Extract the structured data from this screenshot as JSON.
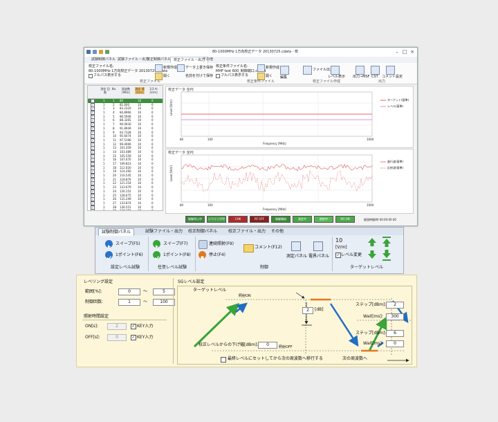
{
  "window": {
    "title": "80-1000MHz 1方向校正データ 20130725.cdata - 校",
    "menu_tabs": [
      "試験制御パネル",
      "試験ファイル・出力",
      "校正制御パネル",
      "校正ファイル・出力",
      "その他"
    ],
    "active_menu_tab": 3,
    "ribbon": {
      "file1_label": "校正ファイル名:",
      "file1_value": "80-1000MHz 1方向校正データ 20130725.cdata",
      "file1_option": "フルパス表示する",
      "new_create": "新規作成",
      "open": "開く",
      "data_save": "データ上書き保存",
      "save_as": "名前を付けて保存",
      "group1": "校正ファイル",
      "file2_label": "校正条件ファイル名:",
      "file2_value": "MHF test 600_制御端口.ccond",
      "file2_option": "フルパス表示する",
      "new_create2": "新規作成",
      "open2": "開く",
      "edit": "編集",
      "group2": "校正条件ファイル",
      "file_output": "ファイル出力",
      "level_sep": "レベル表示",
      "group3": "校正ファイル作成",
      "csv_out": "出力→MSF",
      "cst": "CST",
      "comment": "コメント設定",
      "group4": "出力"
    },
    "table": {
      "headers": [
        "測定\n回数",
        "No.",
        "周波数\n[MHz]",
        "測定\n値\n[V/m]",
        "1/3 Ar\n[V/m]"
      ],
      "rows": [
        [
          "1",
          "1",
          "80",
          "10",
          "0"
        ],
        [
          "1",
          "2",
          "81.600",
          "10",
          "0"
        ],
        [
          "1",
          "3",
          "83.2320",
          "10",
          "0"
        ],
        [
          "1",
          "4",
          "84.8966",
          "10",
          "0"
        ],
        [
          "1",
          "5",
          "86.5946",
          "10",
          "0"
        ],
        [
          "1",
          "6",
          "88.3265",
          "10",
          "0"
        ],
        [
          "1",
          "7",
          "90.0930",
          "10",
          "0"
        ],
        [
          "1",
          "8",
          "91.8949",
          "10",
          "0"
        ],
        [
          "1",
          "9",
          "93.7328",
          "10",
          "0"
        ],
        [
          "1",
          "10",
          "95.6074",
          "10",
          "0"
        ],
        [
          "1",
          "11",
          "97.5196",
          "10",
          "0"
        ],
        [
          "1",
          "12",
          "99.4699",
          "10",
          "0"
        ],
        [
          "1",
          "13",
          "101.459",
          "10",
          "0"
        ],
        [
          "1",
          "14",
          "103.489",
          "10",
          "0"
        ],
        [
          "1",
          "15",
          "105.559",
          "10",
          "0"
        ],
        [
          "1",
          "16",
          "107.670",
          "10",
          "0"
        ],
        [
          "1",
          "17",
          "109.823",
          "10",
          "0"
        ],
        [
          "1",
          "18",
          "112.020",
          "10",
          "0"
        ],
        [
          "1",
          "19",
          "114.260",
          "10",
          "0"
        ],
        [
          "1",
          "20",
          "116.545",
          "10",
          "0"
        ],
        [
          "1",
          "21",
          "118.876",
          "10",
          "0"
        ],
        [
          "1",
          "22",
          "121.254",
          "10",
          "0"
        ],
        [
          "1",
          "23",
          "123.679",
          "10",
          "0"
        ],
        [
          "1",
          "24",
          "126.152",
          "10",
          "0"
        ],
        [
          "1",
          "25",
          "128.675",
          "10",
          "0"
        ],
        [
          "1",
          "26",
          "131.249",
          "10",
          "0"
        ],
        [
          "1",
          "27",
          "133.874",
          "10",
          "0"
        ],
        [
          "1",
          "28",
          "136.551",
          "10",
          "0"
        ],
        [
          "1",
          "29",
          "139.282",
          "10",
          "0"
        ]
      ]
    },
    "chart_top": {
      "title": "校正データ 全円",
      "xlabel": "Frequency [MHz]",
      "ylabel": "Level [V/m]",
      "legend": [
        "ターゲット(基準)",
        "レベル(基準)"
      ],
      "x_ticks": [
        "80",
        "100",
        "1000"
      ]
    },
    "chart_bottom": {
      "title": "校正データ 全円",
      "xlabel": "Frequency [MHz]",
      "ylabel": "Level [V/m]",
      "legend": [
        "進行波(基準)",
        "反射波(基準)"
      ],
      "x_ticks": [
        "80",
        "100",
        "1000"
      ]
    },
    "status_buttons": [
      {
        "label": "制御停止中",
        "color": "#3a8a3a"
      },
      {
        "label": "レベリング中",
        "color": "#4a9d4a"
      },
      {
        "label": "CHK",
        "color": "#b02a2a"
      },
      {
        "label": "RF OFF",
        "color": "#8a1f1f"
      },
      {
        "label": "制御開始",
        "color": "#3a8a3a"
      },
      {
        "label": "測定中",
        "color": "#46a846"
      },
      {
        "label": "照射中",
        "color": "#57b857"
      },
      {
        "label": "RO ON",
        "color": "#4caa4c"
      }
    ],
    "status_right": "経過時間/時 00:00:00.00"
  },
  "panel2": {
    "tabs": [
      "試験制御パネル",
      "試験ファイル・出力",
      "校正制御パネル",
      "校正ファイル・出力",
      "その他"
    ],
    "active_tab": 0,
    "sweep_f5": "スイープ(F5)",
    "point_f6": "1ポイント(F6)",
    "group_setting": "設定レベル試験",
    "sweep_f7": "スイープ(F7)",
    "point_f8": "1ポイント(F8)",
    "group_any": "任意レベル試験",
    "continuous_f9": "連続照射(F9)",
    "stop_f4": "停止(F4)",
    "comment_f12": "コメント(F12)",
    "measure_panel": "測定パネル",
    "field_panel": "電界パネル",
    "group_control": "制御",
    "target_value": "10",
    "target_unit": "[V/m]",
    "level_change": "レベル変更",
    "group_target": "ターゲットレベル"
  },
  "panel3": {
    "leveling_title": "レベリング設定",
    "range_label": "範囲[%]:",
    "range_min": "0",
    "range_max": "5",
    "range_sep": "〜",
    "count_label": "制御回数:",
    "count_min": "1",
    "count_max": "100",
    "count_sep": "〜",
    "timing_title": "照射時間設定",
    "on_label": "ON[s]:",
    "on_value": "2",
    "off_label": "OFF[s]:",
    "off_value": "0",
    "key_input": "KEY入力",
    "sg_title": "SGレベル設定",
    "target_level": "ターゲットレベル",
    "rf_on": "照射ON",
    "rf_off": "照射OFF",
    "db_value": "2",
    "db_unit": "[dB]",
    "lower_label": "校正レベルからの下げ幅[dBm]:",
    "lower_value": "0",
    "step_label": "ステップ[dBm]:",
    "step_value_top": "2",
    "wait_label": "Wait[ms]:",
    "wait_value_top": "300",
    "step_value_bottom": "6",
    "wait_value_bottom": "0",
    "final_check": "最終レベルにセットしてから次の周波数へ移行する",
    "next_freq": "次の周波数へ",
    "colors": {
      "rise": "#3aa33a",
      "sweep": "#1f6fc4",
      "level": "#e07820"
    }
  }
}
